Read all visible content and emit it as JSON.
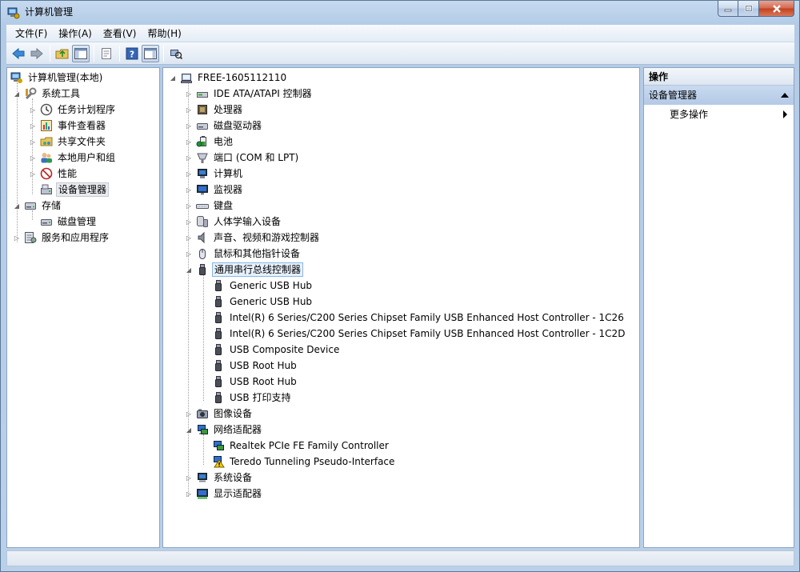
{
  "window": {
    "title": "计算机管理"
  },
  "menu": [
    "文件(F)",
    "操作(A)",
    "查看(V)",
    "帮助(H)"
  ],
  "left_tree": [
    {
      "label": "计算机管理(本地)",
      "level": 0,
      "expander": "none",
      "icon": "computer-management-icon"
    },
    {
      "label": "系统工具",
      "level": 1,
      "expander": "expanded",
      "icon": "system-tools-icon"
    },
    {
      "label": "任务计划程序",
      "level": 2,
      "expander": "collapsed",
      "icon": "clock-icon"
    },
    {
      "label": "事件查看器",
      "level": 2,
      "expander": "collapsed",
      "icon": "event-viewer-icon"
    },
    {
      "label": "共享文件夹",
      "level": 2,
      "expander": "collapsed",
      "icon": "shared-folder-icon"
    },
    {
      "label": "本地用户和组",
      "level": 2,
      "expander": "collapsed",
      "icon": "users-icon"
    },
    {
      "label": "性能",
      "level": 2,
      "expander": "collapsed",
      "icon": "performance-icon"
    },
    {
      "label": "设备管理器",
      "level": 2,
      "expander": "none",
      "icon": "device-manager-icon",
      "selected": true
    },
    {
      "label": "存储",
      "level": 1,
      "expander": "expanded",
      "icon": "storage-icon"
    },
    {
      "label": "磁盘管理",
      "level": 2,
      "expander": "none",
      "icon": "disk-management-icon"
    },
    {
      "label": "服务和应用程序",
      "level": 1,
      "expander": "collapsed",
      "icon": "services-icon"
    }
  ],
  "device_tree": [
    {
      "label": "FREE-1605112110",
      "level": 0,
      "expander": "expanded",
      "icon": "computer-icon"
    },
    {
      "label": "IDE ATA/ATAPI 控制器",
      "level": 1,
      "expander": "collapsed",
      "icon": "ide-controller-icon"
    },
    {
      "label": "处理器",
      "level": 1,
      "expander": "collapsed",
      "icon": "processor-icon"
    },
    {
      "label": "磁盘驱动器",
      "level": 1,
      "expander": "collapsed",
      "icon": "disk-drive-icon"
    },
    {
      "label": "电池",
      "level": 1,
      "expander": "collapsed",
      "icon": "battery-icon"
    },
    {
      "label": "端口 (COM 和 LPT)",
      "level": 1,
      "expander": "collapsed",
      "icon": "port-icon"
    },
    {
      "label": "计算机",
      "level": 1,
      "expander": "collapsed",
      "icon": "computer-icon"
    },
    {
      "label": "监视器",
      "level": 1,
      "expander": "collapsed",
      "icon": "monitor-icon"
    },
    {
      "label": "键盘",
      "level": 1,
      "expander": "collapsed",
      "icon": "keyboard-icon"
    },
    {
      "label": "人体学输入设备",
      "level": 1,
      "expander": "collapsed",
      "icon": "hid-icon"
    },
    {
      "label": "声音、视频和游戏控制器",
      "level": 1,
      "expander": "collapsed",
      "icon": "sound-icon"
    },
    {
      "label": "鼠标和其他指针设备",
      "level": 1,
      "expander": "collapsed",
      "icon": "mouse-icon"
    },
    {
      "label": "通用串行总线控制器",
      "level": 1,
      "expander": "expanded",
      "icon": "usb-icon",
      "focused": true
    },
    {
      "label": "Generic USB Hub",
      "level": 2,
      "expander": "none",
      "icon": "usb-icon"
    },
    {
      "label": "Generic USB Hub",
      "level": 2,
      "expander": "none",
      "icon": "usb-icon"
    },
    {
      "label": "Intel(R) 6 Series/C200 Series Chipset Family USB Enhanced Host Controller - 1C26",
      "level": 2,
      "expander": "none",
      "icon": "usb-icon"
    },
    {
      "label": "Intel(R) 6 Series/C200 Series Chipset Family USB Enhanced Host Controller - 1C2D",
      "level": 2,
      "expander": "none",
      "icon": "usb-icon"
    },
    {
      "label": "USB Composite Device",
      "level": 2,
      "expander": "none",
      "icon": "usb-icon"
    },
    {
      "label": "USB Root Hub",
      "level": 2,
      "expander": "none",
      "icon": "usb-icon"
    },
    {
      "label": "USB Root Hub",
      "level": 2,
      "expander": "none",
      "icon": "usb-icon"
    },
    {
      "label": "USB 打印支持",
      "level": 2,
      "expander": "none",
      "icon": "usb-icon"
    },
    {
      "label": "图像设备",
      "level": 1,
      "expander": "collapsed",
      "icon": "camera-icon"
    },
    {
      "label": "网络适配器",
      "level": 1,
      "expander": "expanded",
      "icon": "network-adapter-icon"
    },
    {
      "label": "Realtek PCIe FE Family Controller",
      "level": 2,
      "expander": "none",
      "icon": "network-adapter-icon"
    },
    {
      "label": "Teredo Tunneling Pseudo-Interface",
      "level": 2,
      "expander": "none",
      "icon": "network-warning-icon"
    },
    {
      "label": "系统设备",
      "level": 1,
      "expander": "collapsed",
      "icon": "system-device-icon"
    },
    {
      "label": "显示适配器",
      "level": 1,
      "expander": "collapsed",
      "icon": "display-adapter-icon"
    }
  ],
  "actions": {
    "header": "操作",
    "section": "设备管理器",
    "items": [
      "更多操作"
    ]
  },
  "colors": {
    "frame": "#b9d0ea",
    "selection": "#e6f1fc",
    "action_section": "#c2d5ee"
  }
}
